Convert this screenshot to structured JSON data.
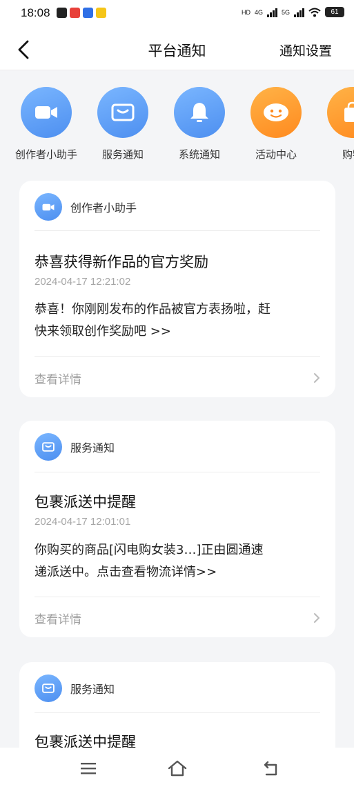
{
  "status_bar": {
    "time": "18:08",
    "network_hd": "HD",
    "network_4g": "4G",
    "network_5g": "5G",
    "battery": "61"
  },
  "header": {
    "title": "平台通知",
    "settings_label": "通知设置"
  },
  "categories": [
    {
      "label": "创作者小助手",
      "icon": "video-camera-icon",
      "color": "#5a9bf6"
    },
    {
      "label": "服务通知",
      "icon": "envelope-icon",
      "color": "#5a9bf6"
    },
    {
      "label": "系统通知",
      "icon": "bell-icon",
      "color": "#5a9bf6"
    },
    {
      "label": "活动中心",
      "icon": "smiley-icon",
      "color": "#ff9a2e"
    },
    {
      "label": "购物",
      "icon": "shopping-bag-icon",
      "color": "#ff9a2e"
    }
  ],
  "notifications": [
    {
      "category": "创作者小助手",
      "icon": "video-camera-icon",
      "title": "恭喜获得新作品的官方奖励",
      "time": "2024-04-17 12:21:02",
      "body_line1": "恭喜！你刚刚发布的作品被官方表扬啦，赶",
      "body_line2": "快来领取创作奖励吧 >>",
      "detail_label": "查看详情"
    },
    {
      "category": "服务通知",
      "icon": "envelope-icon",
      "title": "包裹派送中提醒",
      "time": "2024-04-17 12:01:01",
      "body_line1": "你购买的商品[闪电购女装3…]正由圆通速",
      "body_line2": "递派送中。点击查看物流详情>>",
      "detail_label": "查看详情"
    },
    {
      "category": "服务通知",
      "icon": "envelope-icon",
      "title": "包裹派送中提醒"
    }
  ],
  "bottom_nav": {
    "menu_icon": "menu-icon",
    "home_icon": "home-icon",
    "back_icon": "back-icon"
  }
}
